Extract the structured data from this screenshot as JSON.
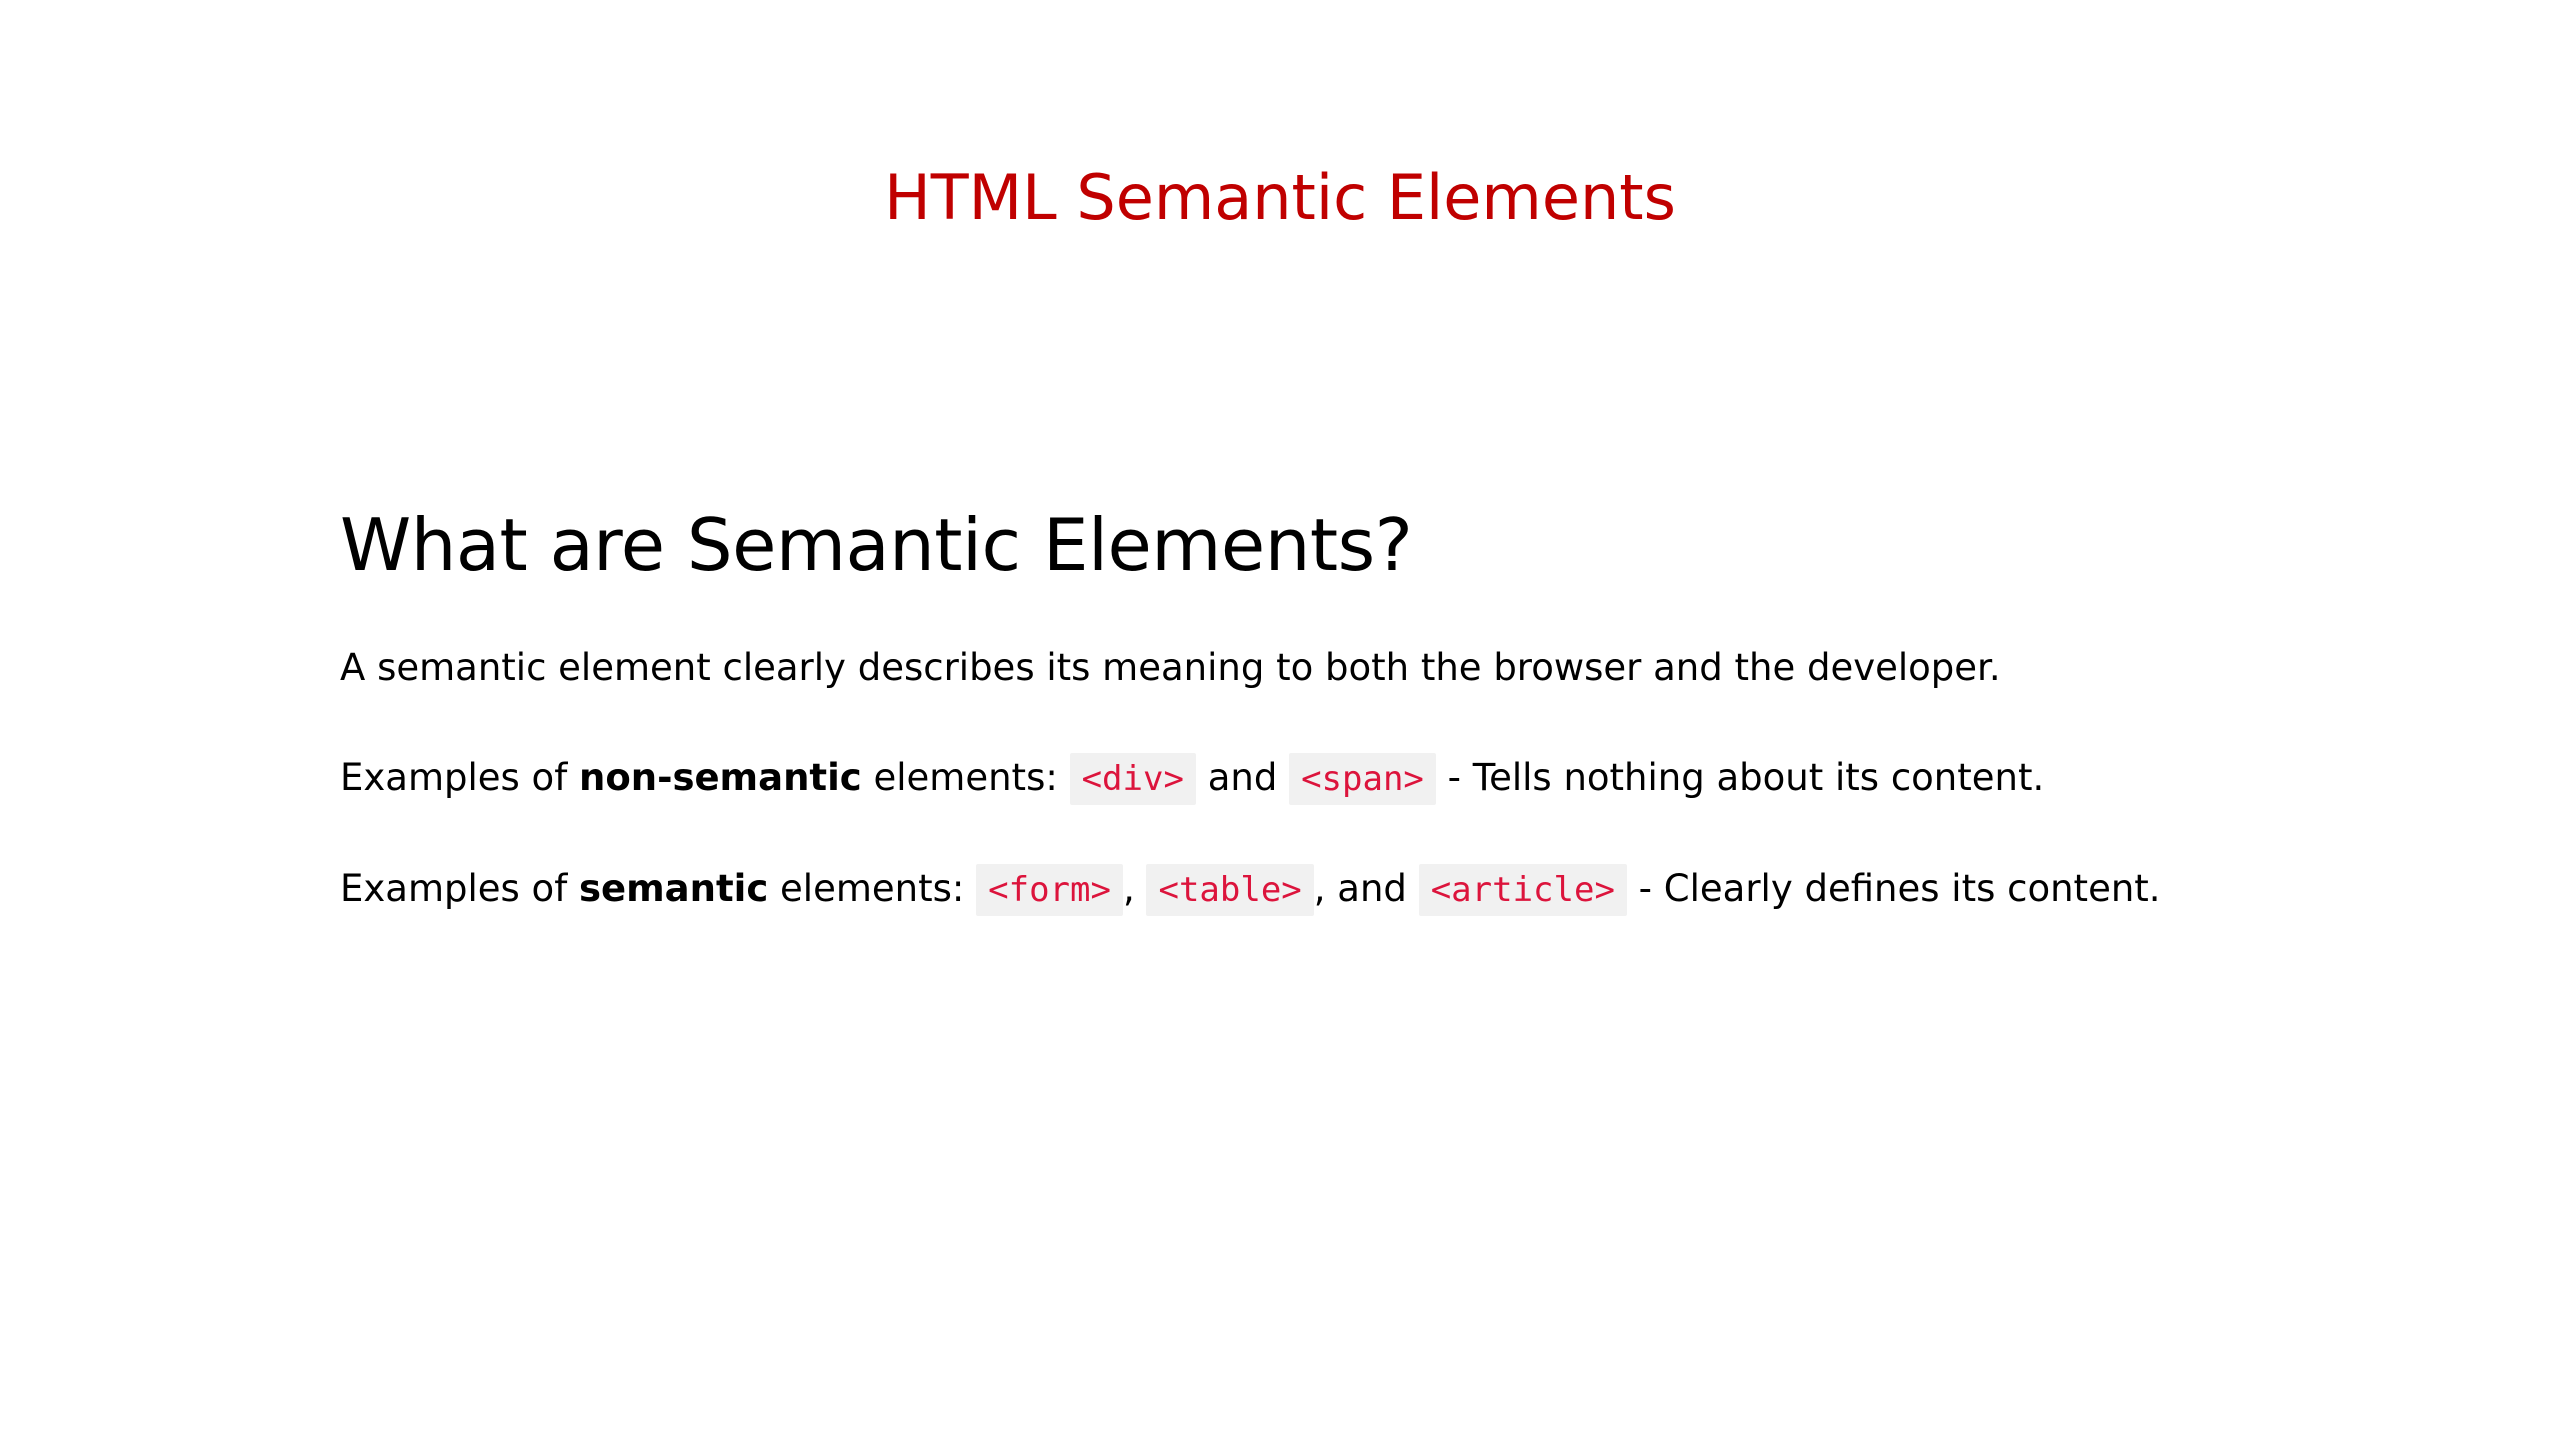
{
  "slide": {
    "title": "HTML Semantic Elements",
    "title_color": "#c00000"
  },
  "main": {
    "heading": "What are Semantic Elements?",
    "definition": "A semantic element clearly describes its meaning to both the browser and the developer.",
    "non_semantic": {
      "prefix": "Examples of ",
      "bold": "non-semantic",
      "after_bold": " elements: ",
      "tag1": "<div>",
      "connector": " and ",
      "tag2": "<span>",
      "suffix": " - Tells nothing about its content."
    },
    "semantic": {
      "prefix": "Examples of ",
      "bold": "semantic",
      "after_bold": " elements: ",
      "tag1": "<form>",
      "sep1": ", ",
      "tag2": "<table>",
      "sep2": ", and ",
      "tag3": "<article>",
      "suffix": " - Clearly defines its content."
    },
    "code_color": "#dc143c",
    "code_background": "#f1f1f1"
  }
}
